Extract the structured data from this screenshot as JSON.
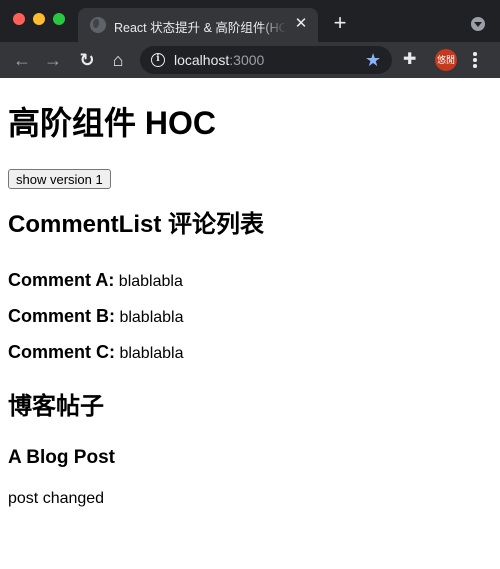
{
  "browser": {
    "tab": {
      "title": "React 状态提升 & 高阶组件(HOC)",
      "close_glyph": "✕",
      "favicon": "globe-icon"
    },
    "new_tab_glyph": "+",
    "toolbar": {
      "back_glyph": "←",
      "forward_glyph": "→",
      "reload_glyph": "↻",
      "home_glyph": "⌂",
      "info_glyph": "i",
      "url_host": "localhost",
      "url_port": ":3000",
      "star_glyph": "★",
      "extensions_glyph": "✚",
      "profile_label": "悠閒"
    }
  },
  "page": {
    "title": "高阶组件 HOC",
    "toggle_button": "show version 1",
    "comments": {
      "heading": "CommentList 评论列表",
      "items": [
        {
          "label": "Comment A:",
          "text": "blablabla"
        },
        {
          "label": "Comment B:",
          "text": "blablabla"
        },
        {
          "label": "Comment C:",
          "text": "blablabla"
        }
      ]
    },
    "blog": {
      "heading": "博客帖子",
      "post_title": "A Blog Post",
      "post_body": "post changed"
    }
  }
}
